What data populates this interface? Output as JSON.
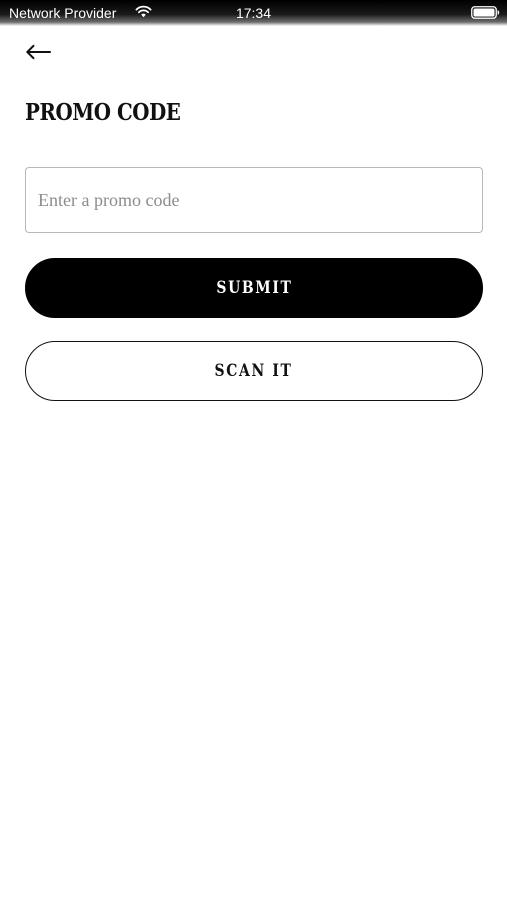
{
  "status_bar": {
    "carrier": "Network Provider",
    "time": "17:34",
    "icons": [
      "wifi-icon",
      "battery-icon"
    ]
  },
  "header": {
    "back_icon": "back-arrow-icon",
    "title": "PROMO CODE"
  },
  "form": {
    "promo_input": {
      "value": "",
      "placeholder": "Enter a promo code"
    },
    "submit_label": "SUBMIT",
    "scan_label": "SCAN IT"
  },
  "colors": {
    "primary": "#000000",
    "background": "#ffffff",
    "input_border": "#b8b8b8",
    "placeholder": "#8c8c8c"
  }
}
